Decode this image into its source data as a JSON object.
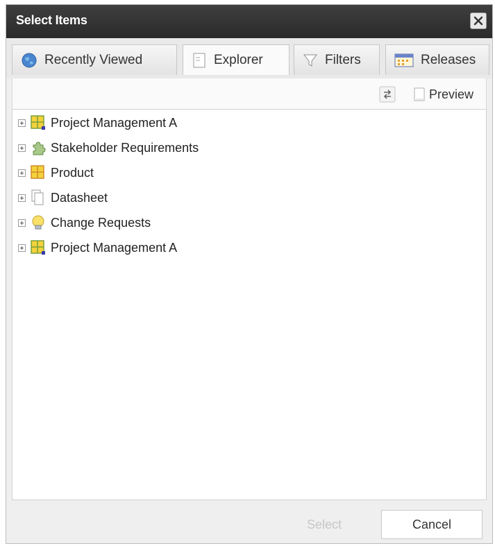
{
  "dialog": {
    "title": "Select Items"
  },
  "tabs": [
    {
      "label": "Recently Viewed",
      "icon": "globe-icon"
    },
    {
      "label": "Explorer",
      "icon": "document-icon"
    },
    {
      "label": "Filters",
      "icon": "funnel-icon"
    },
    {
      "label": "Releases",
      "icon": "calendar-icon"
    }
  ],
  "toolbar": {
    "preview_label": "Preview"
  },
  "tree": {
    "items": [
      {
        "label": "Project Management A",
        "icon": "grid-icon"
      },
      {
        "label": "Stakeholder Requirements",
        "icon": "puzzle-icon"
      },
      {
        "label": "Product",
        "icon": "grid-icon"
      },
      {
        "label": "Datasheet",
        "icon": "pages-icon"
      },
      {
        "label": "Change Requests",
        "icon": "lightbulb-icon"
      },
      {
        "label": "Project Management A",
        "icon": "grid-icon"
      }
    ]
  },
  "footer": {
    "select_label": "Select",
    "cancel_label": "Cancel"
  },
  "colors": {
    "titlebar": "#333333",
    "accent_yellow": "#f4d23c",
    "dialog_bg": "#efefef"
  }
}
